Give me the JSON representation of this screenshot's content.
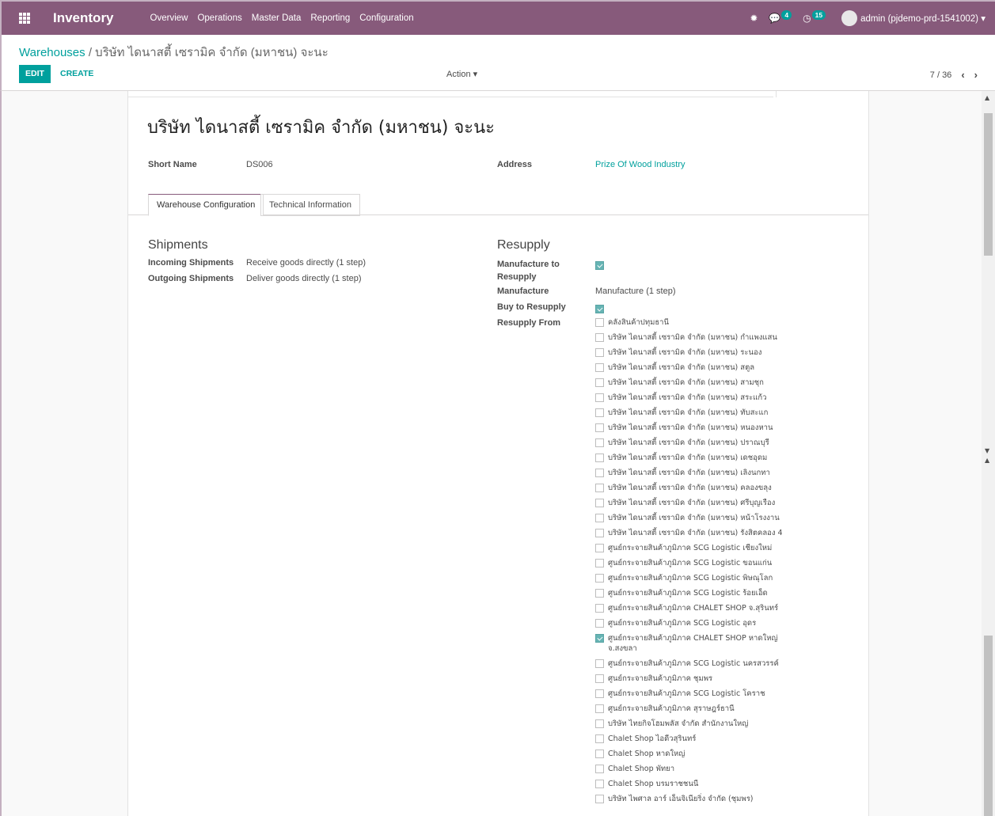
{
  "navbar": {
    "brand": "Inventory",
    "menu": [
      "Overview",
      "Operations",
      "Master Data",
      "Reporting",
      "Configuration"
    ],
    "messages_count": "4",
    "activities_count": "15",
    "user": "admin (pjdemo-prd-1541002)"
  },
  "control": {
    "breadcrumb_parent": "Warehouses",
    "breadcrumb_sep": "/",
    "breadcrumb_current": "บริษัท ไดนาสตี้ เซรามิค จำกัด (มหาชน) จะนะ",
    "edit_label": "EDIT",
    "create_label": "CREATE",
    "action_label": "Action",
    "pager": "7 / 36"
  },
  "form": {
    "title": "บริษัท ไดนาสตี้ เซรามิค จำกัด (มหาชน) จะนะ",
    "short_name_label": "Short Name",
    "short_name": "DS006",
    "address_label": "Address",
    "address": "Prize Of Wood Industry",
    "tabs": [
      "Warehouse Configuration",
      "Technical Information"
    ]
  },
  "shipments": {
    "title": "Shipments",
    "incoming_label": "Incoming Shipments",
    "incoming_value": "Receive goods directly (1 step)",
    "outgoing_label": "Outgoing Shipments",
    "outgoing_value": "Deliver goods directly (1 step)"
  },
  "resupply": {
    "title": "Resupply",
    "manufacture_to_resupply_label": "Manufacture to Resupply",
    "manufacture_to_resupply": true,
    "manufacture_label": "Manufacture",
    "manufacture_value": "Manufacture (1 step)",
    "buy_to_resupply_label": "Buy to Resupply",
    "buy_to_resupply": true,
    "resupply_from_label": "Resupply From",
    "items": [
      {
        "label": "คลังสินค้าปทุมธานี",
        "checked": false
      },
      {
        "label": "บริษัท ไดนาสตี้ เซรามิค จำกัด (มหาชน) กำแพงแสน",
        "checked": false
      },
      {
        "label": "บริษัท ไดนาสตี้ เซรามิค จำกัด (มหาชน) ระนอง",
        "checked": false
      },
      {
        "label": "บริษัท ไดนาสตี้ เซรามิค จำกัด (มหาชน) สตูล",
        "checked": false
      },
      {
        "label": "บริษัท ไดนาสตี้ เซรามิค จำกัด (มหาชน) สามชุก",
        "checked": false
      },
      {
        "label": "บริษัท ไดนาสตี้ เซรามิค จำกัด (มหาชน) สระแก้ว",
        "checked": false
      },
      {
        "label": "บริษัท ไดนาสตี้ เซรามิค จำกัด (มหาชน) ทับสะแก",
        "checked": false
      },
      {
        "label": "บริษัท ไดนาสตี้ เซรามิค จำกัด (มหาชน) หนองหาน",
        "checked": false
      },
      {
        "label": "บริษัท ไดนาสตี้ เซรามิค จำกัด (มหาชน) ปราณบุรี",
        "checked": false
      },
      {
        "label": "บริษัท ไดนาสตี้ เซรามิค จำกัด (มหาชน) เดชอุดม",
        "checked": false
      },
      {
        "label": "บริษัท ไดนาสตี้ เซรามิค จำกัด (มหาชน) เลิงนกทา",
        "checked": false
      },
      {
        "label": "บริษัท ไดนาสตี้ เซรามิค จำกัด (มหาชน) คลองขลุง",
        "checked": false
      },
      {
        "label": "บริษัท ไดนาสตี้ เซรามิค จำกัด (มหาชน) ศรีบุญเรือง",
        "checked": false
      },
      {
        "label": "บริษัท ไดนาสตี้ เซรามิค จำกัด (มหาชน) หน้าโรงงาน",
        "checked": false
      },
      {
        "label": "บริษัท ไดนาสตี้ เซรามิค จำกัด (มหาชน) รังสิตคลอง 4",
        "checked": false
      },
      {
        "label": "ศูนย์กระจายสินค้าภูมิภาค SCG Logistic เชียงใหม่",
        "checked": false
      },
      {
        "label": "ศูนย์กระจายสินค้าภูมิภาค SCG Logistic ขอนแก่น",
        "checked": false
      },
      {
        "label": "ศูนย์กระจายสินค้าภูมิภาค SCG Logistic พิษณุโลก",
        "checked": false
      },
      {
        "label": "ศูนย์กระจายสินค้าภูมิภาค SCG Logistic ร้อยเอ็ด",
        "checked": false
      },
      {
        "label": "ศูนย์กระจายสินค้าภูมิภาค CHALET SHOP จ.สุรินทร์",
        "checked": false
      },
      {
        "label": "ศูนย์กระจายสินค้าภูมิภาค SCG Logistic อุดร",
        "checked": false
      },
      {
        "label": "ศูนย์กระจายสินค้าภูมิภาค CHALET SHOP หาดใหญ่ จ.สงขลา",
        "checked": true
      },
      {
        "label": "ศูนย์กระจายสินค้าภูมิภาค SCG Logistic นครสวรรค์",
        "checked": false
      },
      {
        "label": "ศูนย์กระจายสินค้าภูมิภาค ชุมพร",
        "checked": false
      },
      {
        "label": "ศูนย์กระจายสินค้าภูมิภาค SCG Logistic โคราช",
        "checked": false
      },
      {
        "label": "ศูนย์กระจายสินค้าภูมิภาค สุราษฎร์ธานี",
        "checked": false
      },
      {
        "label": "บริษัท ไทยกิจโฮมพลัส จำกัด สำนักงานใหญ่",
        "checked": false
      },
      {
        "label": "Chalet Shop ไอดีวสุรินทร์",
        "checked": false
      },
      {
        "label": "Chalet Shop หาดใหญ่",
        "checked": false
      },
      {
        "label": "Chalet Shop พัทยา",
        "checked": false
      },
      {
        "label": "Chalet Shop บรมราชชนนี",
        "checked": false
      },
      {
        "label": "บริษัท ไพศาล อาร์ เอ็นจิเนียริ่ง จำกัด (ชุมพร)",
        "checked": false
      }
    ]
  }
}
